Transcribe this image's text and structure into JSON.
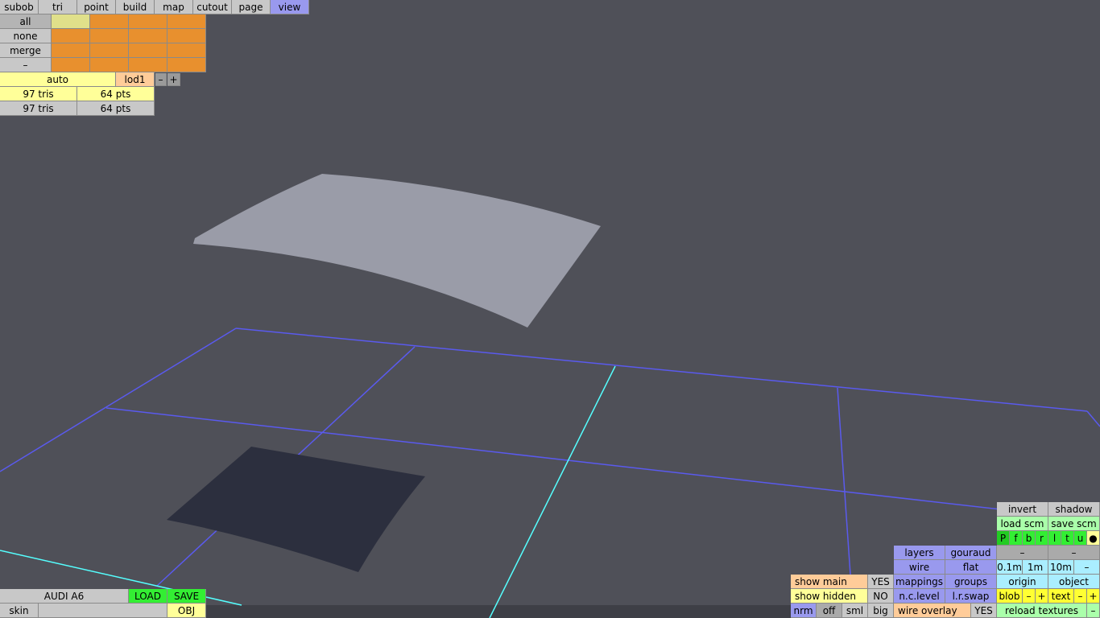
{
  "menu": {
    "tabs": [
      "subob",
      "tri",
      "point",
      "build",
      "map",
      "cutout",
      "page",
      "view"
    ],
    "active": "view"
  },
  "subob_panel": {
    "buttons": [
      "all",
      "none",
      "merge",
      "–"
    ]
  },
  "lod": {
    "auto_label": "auto",
    "lod_label": "lod1",
    "minus": "–",
    "plus": "+"
  },
  "stats": {
    "row1": {
      "tris": "97 tris",
      "pts": "64 pts"
    },
    "row2": {
      "tris": "97 tris",
      "pts": "64 pts"
    }
  },
  "file": {
    "model_name": "AUDI A6",
    "load": "LOAD",
    "save": "SAVE",
    "skin": "skin",
    "skin_value": "",
    "obj": "OBJ"
  },
  "view_panel": {
    "invert": "invert",
    "shadow": "shadow",
    "load_scm": "load scm",
    "save_scm": "save scm",
    "letters": [
      "P",
      "f",
      "b",
      "r",
      "l",
      "t",
      "u",
      "●"
    ],
    "layers": "layers",
    "gouraud": "gouraud",
    "dash1": "–",
    "dash2": "–",
    "wire": "wire",
    "flat": "flat",
    "grid_sizes": [
      "0.1m",
      "1m",
      "10m",
      "–"
    ],
    "show_main": "show main",
    "show_main_value": "YES",
    "mappings": "mappings",
    "groups": "groups",
    "origin": "origin",
    "object": "object",
    "show_hidden": "show hidden",
    "show_hidden_value": "NO",
    "nc_level": "n.c.level",
    "lr_swap": "l.r.swap",
    "blob": "blob",
    "text": "text",
    "minus": "–",
    "plus": "+",
    "nrm": "nrm",
    "off": "off",
    "sml": "sml",
    "big": "big",
    "wire_overlay": "wire overlay",
    "wire_overlay_value": "YES",
    "reload_textures": "reload textures",
    "reload_minus": "–"
  },
  "colors": {
    "background": "#4f5058",
    "grid_line": "#5a5aee",
    "axis_line": "#55ffff",
    "surface": "#9a9ca8",
    "shadow": "#2c2f3e",
    "active_tab": "#9999ee"
  }
}
